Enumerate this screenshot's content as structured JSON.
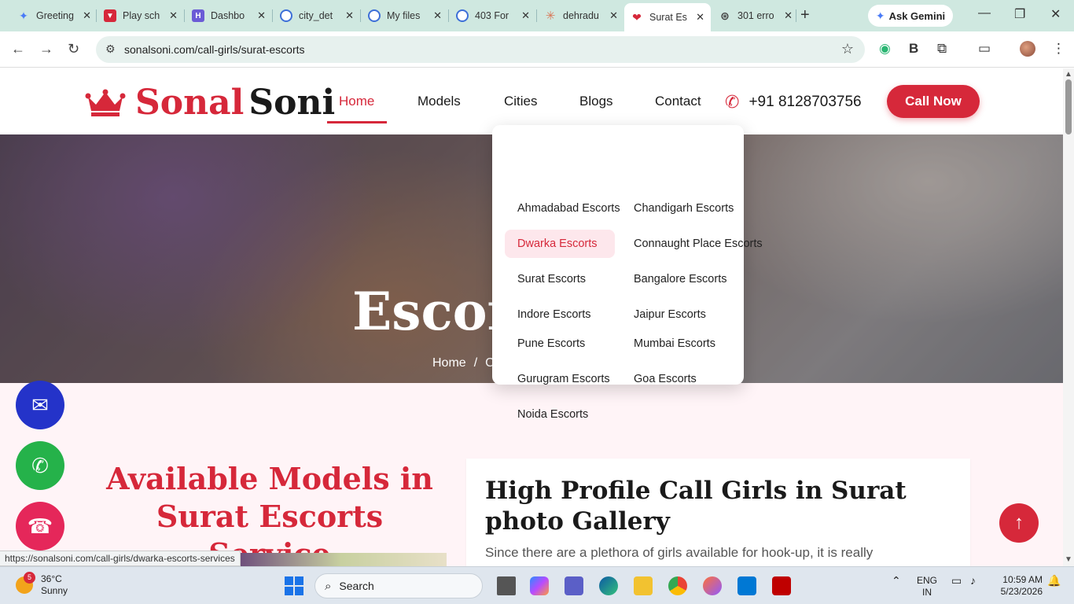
{
  "browser": {
    "tabs": [
      {
        "label": "Greeting",
        "color": "#4a7bf7"
      },
      {
        "label": "Play sch",
        "color": "#d6283a"
      },
      {
        "label": "Dashbo",
        "color": "#6b5bd6"
      },
      {
        "label": "city_det",
        "color": "#3d6fd8"
      },
      {
        "label": "My files",
        "color": "#3d6fd8"
      },
      {
        "label": "403 For",
        "color": "#3d6fd8"
      },
      {
        "label": "dehradu",
        "color": "#d97757"
      },
      {
        "label": "Surat Es",
        "color": "#d6283a"
      },
      {
        "label": "301 erro",
        "color": "#444444"
      }
    ],
    "ask_gemini": "Ask Gemini",
    "url": "sonalsoni.com/call-girls/surat-escorts",
    "status_url": "https://sonalsoni.com/call-girls/dwarka-escorts-services"
  },
  "site": {
    "logo_part1": "Sonal",
    "logo_part2": "Soni",
    "nav": [
      "Home",
      "Models",
      "Cities",
      "Blogs",
      "Contact"
    ],
    "phone": "+91 8128703756",
    "call_now": "Call Now",
    "hero_title": "Escort",
    "breadcrumb": [
      "Home",
      "/",
      "C"
    ],
    "dropdown": [
      "Ahmadabad Escorts",
      "Chandigarh Escorts",
      "Dwarka Escorts",
      "Connaught Place Escorts",
      "Surat Escorts",
      "Bangalore Escorts",
      "Indore Escorts",
      "Jaipur Escorts",
      "Pune Escorts",
      "Mumbai Escorts",
      "Gurugram Escorts",
      "Goa Escorts",
      "Noida Escorts"
    ],
    "available_heading": "Available Models in Surat Escorts Service",
    "gallery_title": "High Profile Call Girls in Surat photo Gallery",
    "gallery_text": "Since there are a plethora of girls available for hook-up, it is really",
    "accent_color": "#d6283a"
  },
  "taskbar": {
    "weather_temp": "36°C",
    "weather_desc": "Sunny",
    "weather_badge": "5",
    "search": "Search",
    "lang1": "ENG",
    "lang2": "IN",
    "time": "10:59 AM",
    "date": "5/23/2026"
  }
}
